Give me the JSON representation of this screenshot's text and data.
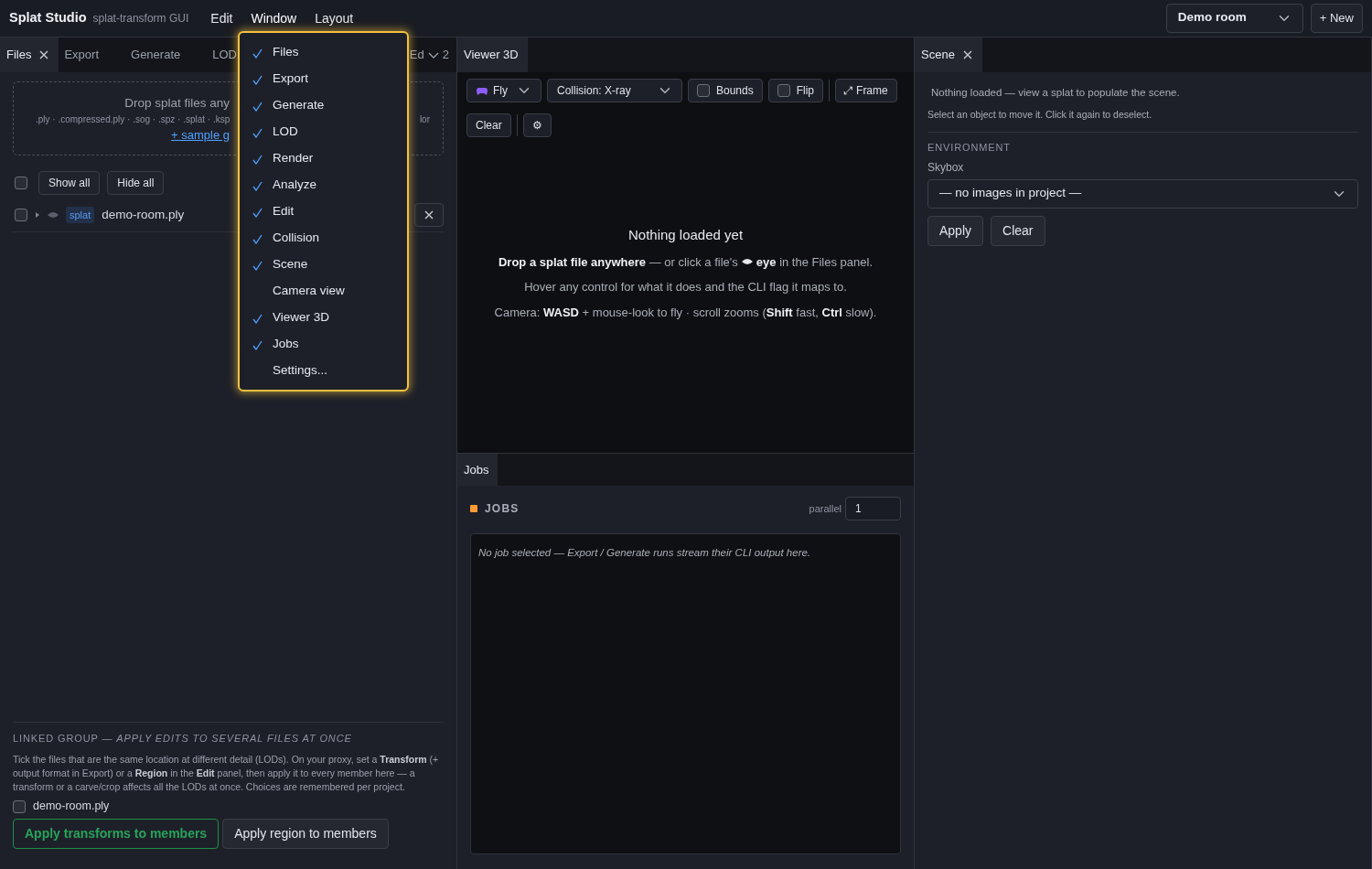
{
  "topbar": {
    "brand": "Splat Studio",
    "subtitle": "splat-transform GUI",
    "menus": [
      {
        "label": "Edit",
        "open": false
      },
      {
        "label": "Window",
        "open": true
      },
      {
        "label": "Layout",
        "open": false
      }
    ],
    "project": "Demo room",
    "new_button": "+ New"
  },
  "window_menu": {
    "items": [
      {
        "label": "Files",
        "checked": true
      },
      {
        "label": "Export",
        "checked": true
      },
      {
        "label": "Generate",
        "checked": true
      },
      {
        "label": "LOD",
        "checked": true
      },
      {
        "label": "Render",
        "checked": true
      },
      {
        "label": "Analyze",
        "checked": true
      },
      {
        "label": "Edit",
        "checked": true
      },
      {
        "label": "Collision",
        "checked": true
      },
      {
        "label": "Scene",
        "checked": true
      },
      {
        "label": "Camera view",
        "checked": false
      },
      {
        "label": "Viewer 3D",
        "checked": true
      },
      {
        "label": "Jobs",
        "checked": true
      },
      {
        "label": "Settings...",
        "checked": false
      }
    ]
  },
  "files_panel": {
    "tabs": [
      {
        "label": "Files",
        "selected": true,
        "closable": true
      },
      {
        "label": "Export",
        "selected": false,
        "closable": false
      },
      {
        "label": "Generate",
        "selected": false,
        "closable": false
      },
      {
        "label": "LOD",
        "selected": false,
        "closable": false
      }
    ],
    "cut_tab": "Ed",
    "overflow_count": "2",
    "dropzone": {
      "title": "Drop splat files any",
      "formats": ".ply · .compressed.ply · .sog · .spz · .splat · .ksp",
      "formats_tail": "lor",
      "link": "+ sample g"
    },
    "show_all": "Show all",
    "hide_all": "Hide all",
    "all_checked": false,
    "files": [
      {
        "badge": "splat",
        "name": "demo-room.ply",
        "checked": false
      }
    ],
    "linked": {
      "heading": "LINKED GROUP — *APPLY EDITS TO SEVERAL FILES AT ONCE*",
      "text": "Tick the files that are the same location at different detail (LODs). On your proxy, set a **Transform** (+ output format in Export) or a **Region** in the **Edit** panel, then apply it to every member here — a transform or a carve/crop affects all the LODs at once. Choices are remembered per project.",
      "members": [
        {
          "name": "demo-room.ply",
          "checked": false
        }
      ],
      "apply_transforms": "Apply transforms to members",
      "apply_region": "Apply region to members"
    }
  },
  "viewer": {
    "tab": "Viewer 3D",
    "mode": "Fly",
    "collision": "Collision: X-ray",
    "toggles": [
      {
        "label": "Bounds",
        "checked": false
      },
      {
        "label": "Flip",
        "checked": false
      }
    ],
    "frame_icon": "⤢",
    "frame": "Frame",
    "clear": "Clear",
    "settings": "⚙",
    "empty": {
      "title": "Nothing loaded yet",
      "line1_before": "**Drop a splat file anywhere** — or click a file's",
      "line1_after": "**eye** in the Files panel.",
      "line2": "Hover any control for what it does and the CLI flag it maps to.",
      "line3": "Camera: **WASD** + mouse-look to fly · scroll zooms (**Shift** fast, **Ctrl** slow)."
    }
  },
  "jobs": {
    "tab": "Jobs",
    "heading": "JOBS",
    "color": "#fd9c35",
    "parallel_label": "parallel",
    "parallel": "1",
    "message": "No job selected — Export / Generate runs stream their CLI output here."
  },
  "scene": {
    "tab": "Scene",
    "empty": "Nothing loaded — view a splat to populate the scene.",
    "hint": "Select an object to move it. Click it again to deselect.",
    "section": "ENVIRONMENT",
    "skybox_label": "Skybox",
    "skybox": "— no images in project —",
    "apply": "Apply",
    "clear": "Clear"
  }
}
